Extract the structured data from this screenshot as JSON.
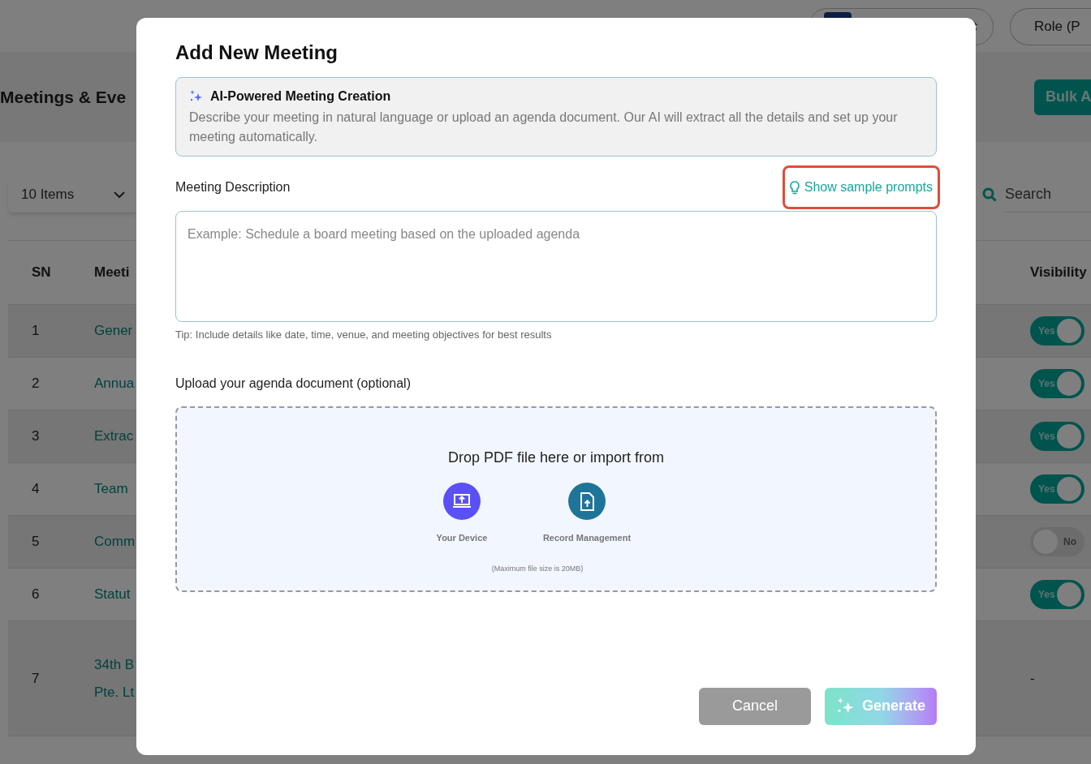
{
  "background_page": {
    "top_bar": {
      "role_pill": "Role (P"
    },
    "page_title": "Meetings & Eve",
    "bulk_button": "Bulk A",
    "page_size_select": "10 Items",
    "search": {
      "placeholder": "Search"
    },
    "table": {
      "columns": [
        "SN",
        "Meeti",
        "Visibility"
      ],
      "rows": [
        {
          "sn": "1",
          "name": [
            "Gener"
          ],
          "visibility": {
            "kind": "toggle",
            "on": true,
            "label": "Yes"
          }
        },
        {
          "sn": "2",
          "name": [
            "Annua"
          ],
          "visibility": {
            "kind": "toggle",
            "on": true,
            "label": "Yes"
          }
        },
        {
          "sn": "3",
          "name": [
            "Extrac"
          ],
          "visibility": {
            "kind": "toggle",
            "on": true,
            "label": "Yes"
          }
        },
        {
          "sn": "4",
          "name": [
            "Team"
          ],
          "visibility": {
            "kind": "toggle",
            "on": true,
            "label": "Yes"
          }
        },
        {
          "sn": "5",
          "name": [
            "Comm"
          ],
          "visibility": {
            "kind": "toggle",
            "on": false,
            "label": "No"
          }
        },
        {
          "sn": "6",
          "name": [
            "Statut"
          ],
          "visibility": {
            "kind": "toggle",
            "on": true,
            "label": "Yes"
          }
        },
        {
          "sn": "7",
          "name": [
            "34th B",
            "Pte. Lt"
          ],
          "visibility": {
            "kind": "text",
            "text": "-"
          }
        }
      ]
    }
  },
  "modal": {
    "title": "Add New Meeting",
    "ai_banner": {
      "title": "AI-Powered Meeting Creation",
      "text": "Describe your meeting in natural language or upload an agenda document. Our AI will extract all the details and set up your meeting automatically."
    },
    "description": {
      "label": "Meeting Description",
      "sample_link": {
        "label": "Show sample prompts",
        "highlighted": true
      },
      "placeholder": "Example: Schedule a board meeting based on the uploaded agenda",
      "tip": "Tip: Include details like date, time, venue, and meeting objectives for best results"
    },
    "upload": {
      "label": "Upload your agenda document (optional)",
      "drop_text": "Drop PDF file here or import from",
      "sources": [
        {
          "kind": "device",
          "label": "Your Device"
        },
        {
          "kind": "records",
          "label": "Record Management"
        }
      ],
      "note": "(Maximum file size is 20MB)"
    },
    "buttons": {
      "cancel": "Cancel",
      "generate": "Generate"
    }
  }
}
